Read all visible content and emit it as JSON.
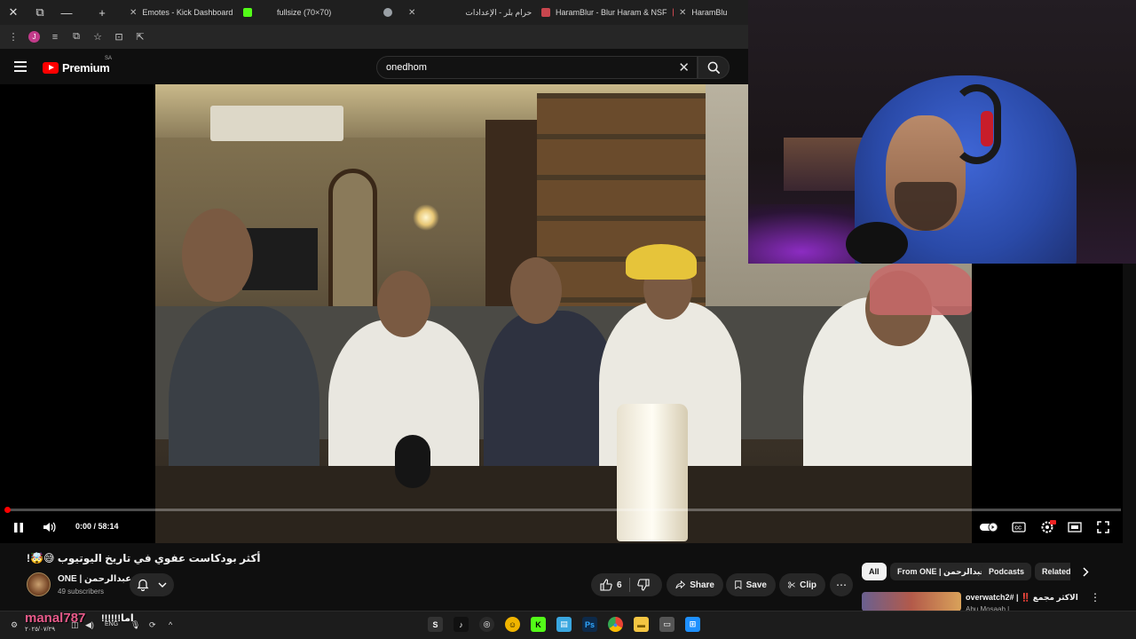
{
  "browser": {
    "tabs": [
      {
        "label": "Emotes - Kick Dashboard",
        "favicon_color": "#53fc18"
      },
      {
        "label": "fullsize (70×70)",
        "favicon_color": "#9aa0a6"
      },
      {
        "label": "حرام بلر - الإعدادات",
        "favicon_color": "#5a6fd1"
      },
      {
        "label": "HaramBlur - Blur Haram & NSF",
        "favicon_color": "#c8464e"
      },
      {
        "label": "HaramBlur",
        "favicon_color": "#c8464e"
      }
    ],
    "profile_initial": "J"
  },
  "youtube": {
    "logo_text": "Premium",
    "region": "SA",
    "search_value": "onedhom",
    "video": {
      "time_current": "0:00",
      "time_total": "58:14",
      "time_separator": " / ",
      "progress": 0.0
    },
    "title": "أكثر بودكاست عفوي في تاريخ اليوتيوب 😅🤯!",
    "channel": {
      "name": "ONE | عبدالرحمن",
      "subscribers": "49 subscribers"
    },
    "actions": {
      "like_count": "6",
      "share": "Share",
      "save": "Save",
      "clip": "Clip"
    },
    "chips": [
      "All",
      "From ONE | عبدالرحمن",
      "Podcasts",
      "Related"
    ],
    "recommendation": {
      "title": "overwatch2# | ‼️ الاكثر مجمع",
      "meta": "Abu Mosaab | ..."
    }
  },
  "taskbar": {
    "overlay_name": "manal787",
    "overlay_bars": "!!!!!!اما",
    "date": "٢٠٢٥/٠٧/٢٩",
    "lang": "ENG",
    "apps": [
      "S",
      "♪",
      "◎",
      "☺",
      "K",
      "▤",
      "Ps",
      "●",
      "▬",
      "▭",
      "⊞"
    ]
  },
  "colors": {
    "yt_red": "#ff0000",
    "kick_green": "#53fc18",
    "overlay_pink": "#e85a8a"
  }
}
